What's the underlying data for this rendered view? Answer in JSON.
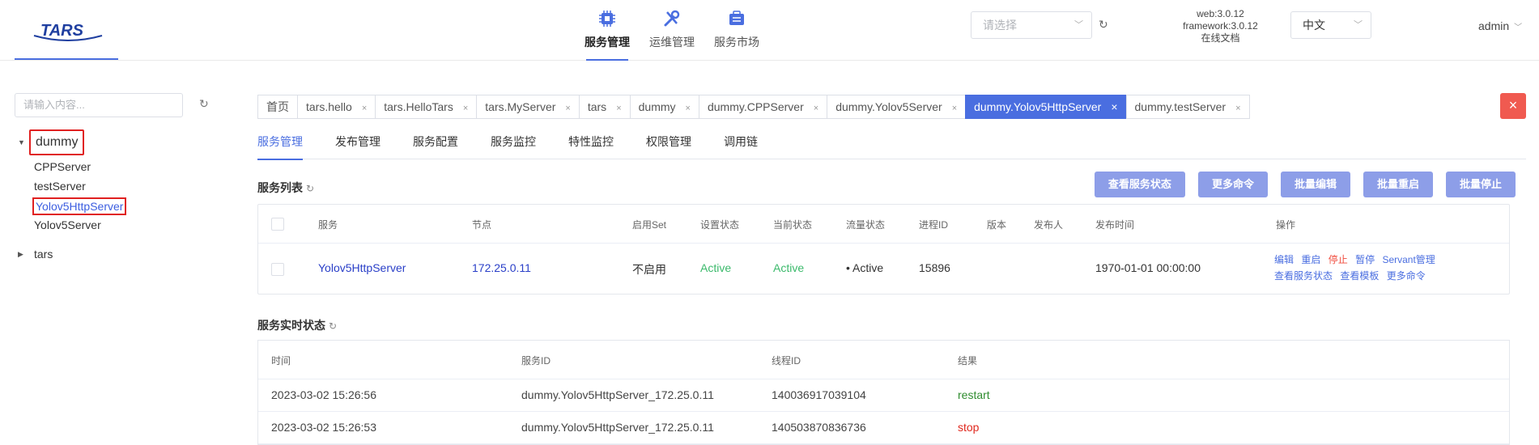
{
  "header": {
    "logo_text": "TARS",
    "nav": [
      {
        "label": "服务管理",
        "icon": "chip-icon",
        "active": true
      },
      {
        "label": "运维管理",
        "icon": "tools-icon",
        "active": false
      },
      {
        "label": "服务市场",
        "icon": "market-icon",
        "active": false
      }
    ],
    "app_select_placeholder": "请选择",
    "version_web": "web:3.0.12",
    "version_framework": "framework:3.0.12",
    "docs_link": "在线文档",
    "language": "中文",
    "user": "admin"
  },
  "sidebar": {
    "search_placeholder": "请输入内容...",
    "tree": [
      {
        "label": "dummy",
        "expanded": true,
        "children": [
          "CPPServer",
          "testServer",
          "Yolov5HttpServer",
          "Yolov5Server"
        ]
      },
      {
        "label": "tars",
        "expanded": false,
        "children": []
      }
    ],
    "selected": "Yolov5HttpServer"
  },
  "tabs": [
    {
      "label": "首页",
      "closable": false
    },
    {
      "label": "tars.hello",
      "closable": true
    },
    {
      "label": "tars.HelloTars",
      "closable": true
    },
    {
      "label": "tars.MyServer",
      "closable": true
    },
    {
      "label": "tars",
      "closable": true
    },
    {
      "label": "dummy",
      "closable": true
    },
    {
      "label": "dummy.CPPServer",
      "closable": true
    },
    {
      "label": "dummy.Yolov5Server",
      "closable": true
    },
    {
      "label": "dummy.Yolov5HttpServer",
      "closable": true,
      "active": true
    },
    {
      "label": "dummy.testServer",
      "closable": true
    }
  ],
  "close_glyph": "×",
  "subtabs": [
    "服务管理",
    "发布管理",
    "服务配置",
    "服务监控",
    "特性监控",
    "权限管理",
    "调用链"
  ],
  "service_list": {
    "title": "服务列表",
    "buttons": [
      "查看服务状态",
      "更多命令",
      "批量编辑",
      "批量重启",
      "批量停止"
    ],
    "columns": [
      "服务",
      "节点",
      "启用Set",
      "设置状态",
      "当前状态",
      "流量状态",
      "进程ID",
      "版本",
      "发布人",
      "发布时间",
      "操作"
    ],
    "rows": [
      {
        "service": "Yolov5HttpServer",
        "node": "172.25.0.11",
        "set": "不启用",
        "setting_status": "Active",
        "current_status": "Active",
        "flow_status": "• Active",
        "pid": "15896",
        "version": "",
        "publisher": "",
        "publish_time": "1970-01-01 00:00:00",
        "ops_line1": [
          "编辑",
          "重启",
          "停止",
          "暂停",
          "Servant管理"
        ],
        "ops_line2": [
          "查看服务状态",
          "查看模板",
          "更多命令"
        ]
      }
    ]
  },
  "realtime": {
    "title": "服务实时状态",
    "columns": [
      "时间",
      "服务ID",
      "线程ID",
      "结果"
    ],
    "rows": [
      {
        "time": "2023-03-02 15:26:56",
        "service_id": "dummy.Yolov5HttpServer_172.25.0.11",
        "thread_id": "140036917039104",
        "result": "restart"
      },
      {
        "time": "2023-03-02 15:26:53",
        "service_id": "dummy.Yolov5HttpServer_172.25.0.11",
        "thread_id": "140503870836736",
        "result": "stop"
      }
    ]
  },
  "colors": {
    "accent": "#4a6ee0",
    "button": "#8d9ee8",
    "danger": "#f05a50",
    "success": "#3cba6c"
  }
}
